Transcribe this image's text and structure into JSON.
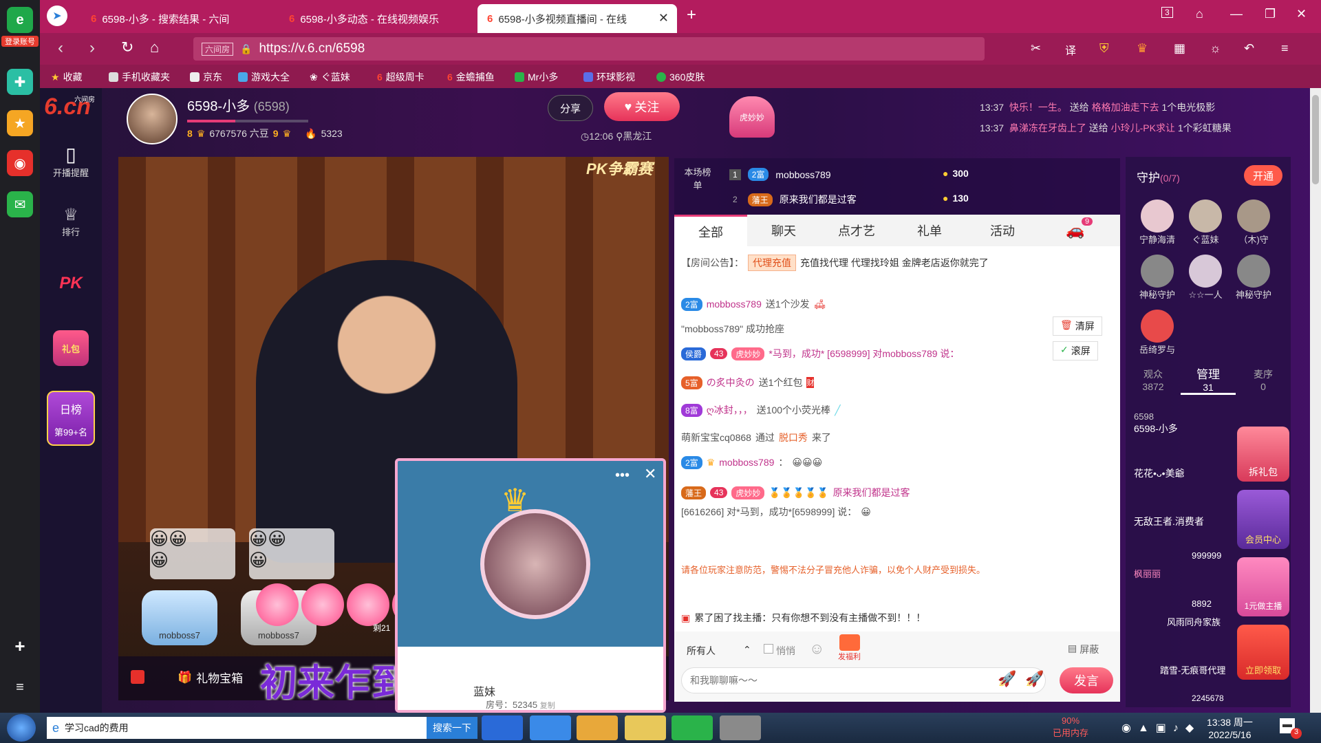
{
  "browser": {
    "login_label": "登录账号",
    "tabs": [
      {
        "label": "6598-小多 - 搜索结果 - 六间"
      },
      {
        "label": "6598-小多动态 - 在线视频娱乐"
      },
      {
        "label": "6598-小多视频直播间 - 在线"
      }
    ],
    "tab_count": "3",
    "url": "https://v.6.cn/6598",
    "url_tag": "六间房",
    "bookmarks": [
      "收藏",
      "手机收藏夹",
      "京东",
      "游戏大全",
      "ぐ蓝妹",
      "超级周卡",
      "金蟾捕鱼",
      "Mr小多",
      "环球影视",
      "360皮肤"
    ]
  },
  "site": {
    "logo": "6.cn",
    "logo_sub": "六间房",
    "nav": [
      {
        "label": "开播提醒"
      },
      {
        "label": "排行"
      },
      {
        "label": "PK"
      },
      {
        "label": "礼包"
      },
      {
        "label": "日榜"
      },
      {
        "label": "第99+名"
      }
    ]
  },
  "anchor": {
    "name": "6598-小多",
    "room_id": "(6598)",
    "level1": "8",
    "beans": "6767576 六豆",
    "level2": "9",
    "heat": "5323",
    "time": "12:06",
    "location": "黑龙江",
    "share_label": "分享",
    "follow_label": "关注"
  },
  "video": {
    "pk_label": "PK争霸赛",
    "banner_text": "初来乍到在江湖上混",
    "gift_box_label": "礼物宝箱",
    "seat1": "mobboss7",
    "seat2": "mobboss7",
    "left_count": "剩21",
    "popup_room": "房号：52345",
    "popup_copy": "复制",
    "popup_text": "蓝妹"
  },
  "notifications": [
    {
      "time": "13:37",
      "user": "快乐！一生。",
      "text": "送给",
      "target": "格格加油走下去",
      "gift": "1个电光极影"
    },
    {
      "time": "13:37",
      "user": "鼻涕冻在牙齿上了",
      "text": "送给",
      "target": "小玲儿-PK求让",
      "gift": "1个彩虹糖果"
    }
  ],
  "rank": {
    "label": "本场榜单",
    "items": [
      {
        "pos": "1",
        "badge": "2富",
        "name": "mobboss789",
        "score": "300"
      },
      {
        "pos": "2",
        "badge": "藩王",
        "name": "原来我们都是过客",
        "score": "130"
      }
    ]
  },
  "chat_tabs": [
    {
      "label": "全部"
    },
    {
      "label": "聊天"
    },
    {
      "label": "点才艺"
    },
    {
      "label": "礼单"
    },
    {
      "label": "活动"
    }
  ],
  "car_count": "9",
  "chat": {
    "notice_label": "【房间公告】：",
    "notice_tag": "代理充值",
    "notice_text": "充值找代理 代理找玲姐 金牌老店返你就完了",
    "msg1_badge": "2富",
    "msg1_user": "mobboss789",
    "msg1_text": "送1个沙发",
    "msg2_text": "\"mobboss789\" 成功抢座",
    "clear_label": "清屏",
    "scroll_label": "滚屏",
    "msg3_badge": "侯爵",
    "msg3_lv": "43",
    "msg3_tag": "虎妙妙",
    "msg3_text": "*马到，成功* [6598999] 对mobboss789 说：",
    "msg4_badge": "5富",
    "msg4_user": "の炙中灸の",
    "msg4_text": "送1个红包",
    "msg5_badge": "8富",
    "msg5_user": "ღ冰封，，，",
    "msg5_text": "送100个小荧光棒",
    "msg6_user": "萌新宝宝cq0868",
    "msg6_via": "通过",
    "msg6_show": "脱口秀",
    "msg6_text": "来了",
    "msg7_badge": "2富",
    "msg7_user": "mobboss789",
    "msg7_text": "：",
    "msg8_badge": "藩王",
    "msg8_lv": "43",
    "msg8_tag": "虎妙妙",
    "msg8_user": "原来我们都是过客",
    "msg8_text": "[6616266] 对*马到，成功*[6598999] 说：",
    "warning": "请各位玩家注意防范，警惕不法分子冒充他人诈骗，以免个人财产受到损失。",
    "sys_text": "累了困了找主播：只有你想不到没有主播做不到！！！",
    "target_label": "所有人",
    "whisper_label": "悄悄",
    "welfare_label": "发福利",
    "block_label": "屏蔽",
    "input_placeholder": "和我聊聊嘛～～",
    "send_label": "发言"
  },
  "guard": {
    "title": "守护",
    "count": "(0/7)",
    "open_label": "开通",
    "members": [
      "宁静海清",
      "ぐ蓝妹",
      "（木)守",
      "神秘守护",
      "☆☆一人",
      "神秘守护",
      "岳绮罗与"
    ],
    "tabs": [
      {
        "label": "观众",
        "value": "3872"
      },
      {
        "label": "管理",
        "value": "31"
      },
      {
        "label": "麦序",
        "value": "0"
      }
    ],
    "users": [
      {
        "name": "6598-小多",
        "sub": "6598"
      },
      {
        "name": "花花•ᴗ•美爺",
        "sub": ""
      },
      {
        "name": "无敌王者.消费者",
        "sub": ""
      },
      {
        "name": "枫丽丽",
        "sub": "999999"
      },
      {
        "name": "风雨同舟家族",
        "sub": "8892"
      },
      {
        "name": "踏雪-无痕哥代理",
        "sub": ""
      },
      {
        "name": "",
        "sub": "2245678"
      }
    ],
    "side_btns": [
      "拆礼包",
      "会员中心",
      "1元做主播",
      "立即领取"
    ]
  },
  "taskbar": {
    "search_app": "学习cad的费用",
    "search_btn": "搜索一下",
    "mem_pct": "90%",
    "mem_label": "已用内存",
    "time": "13:38 周一",
    "date": "2022/5/16",
    "notif": "3"
  },
  "colors": {
    "accent": "#e63b77",
    "tab_bar": "#b31c5e",
    "page_bg": "#2c0f47"
  }
}
